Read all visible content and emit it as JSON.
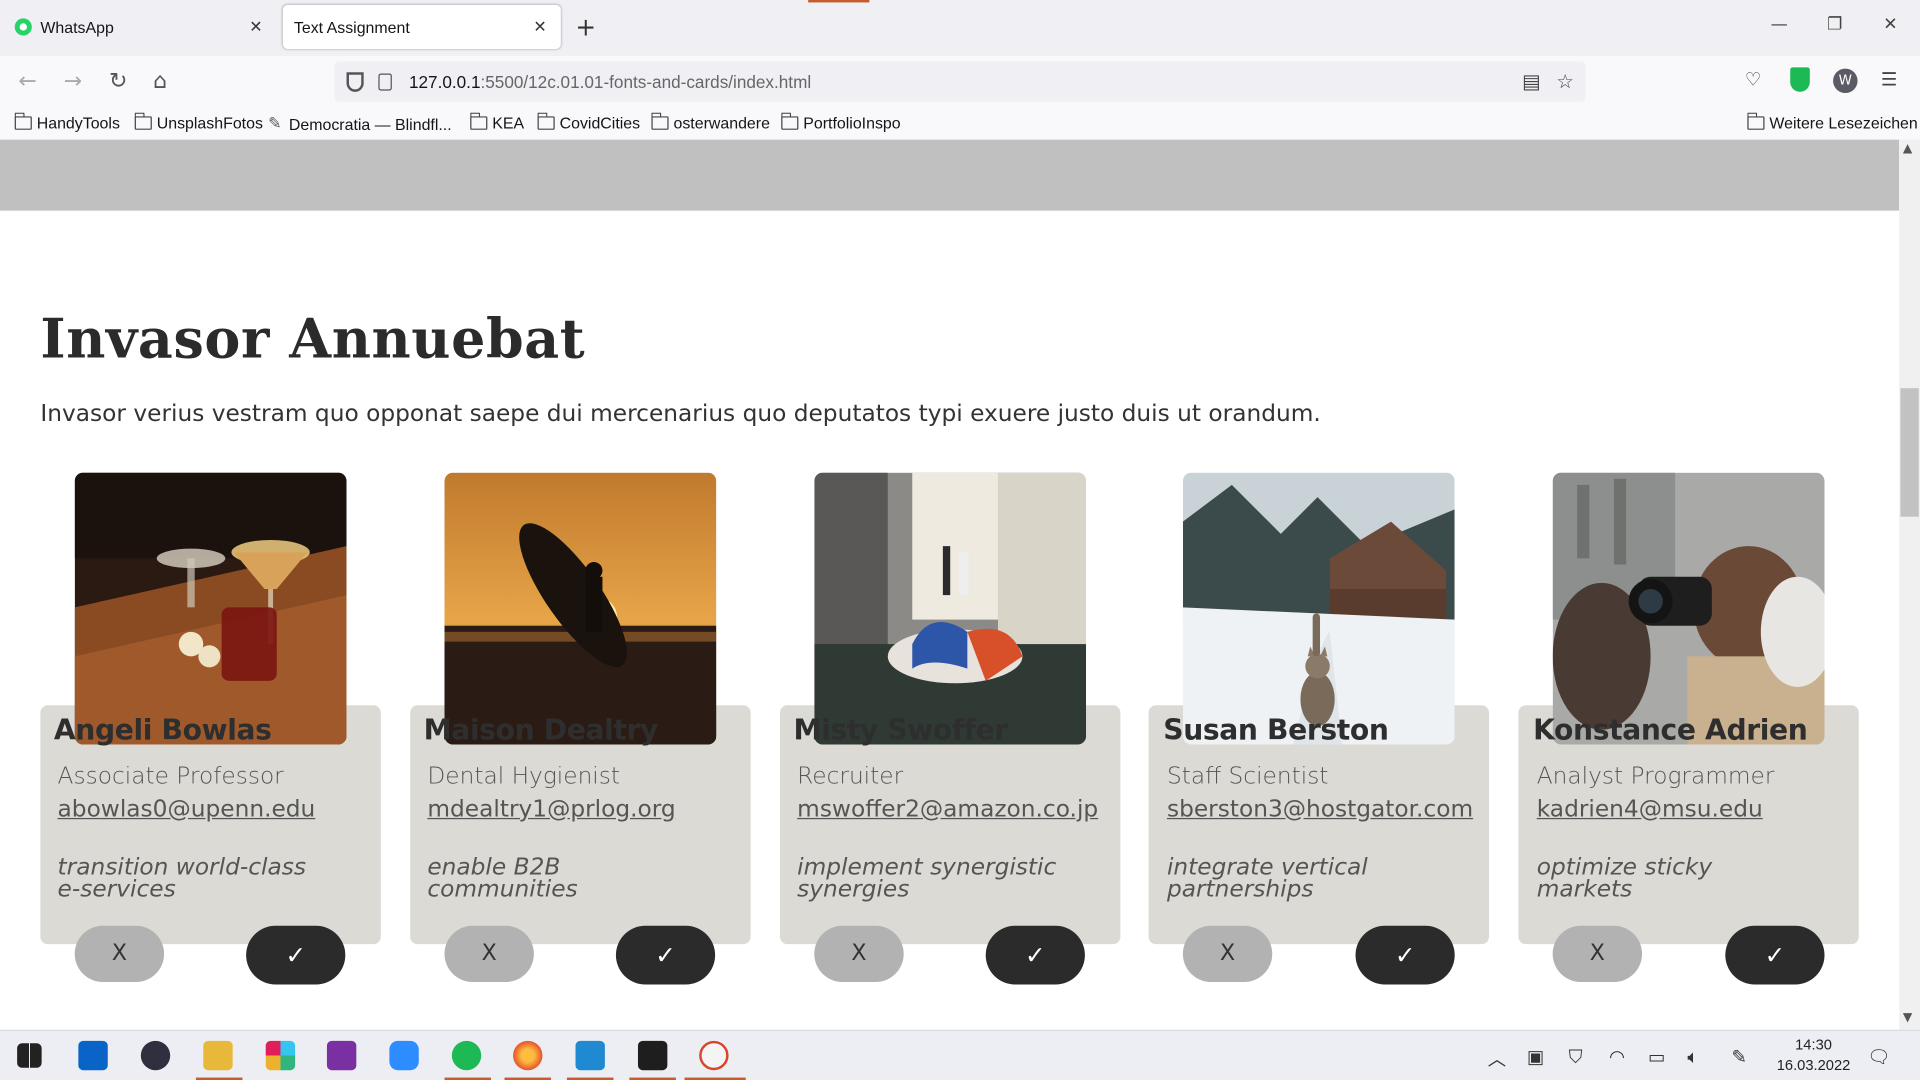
{
  "browser": {
    "tabs": [
      {
        "label": "WhatsApp",
        "active": false
      },
      {
        "label": "Text Assignment",
        "active": true
      }
    ],
    "new_tab": "+",
    "url_host": "127.0.0.1",
    "url_rest": ":5500/12c.01.01-fonts-and-cards/index.html",
    "profile_initial": "W",
    "bookmarks": [
      "HandyTools",
      "UnsplashFotos",
      "Democratia — Blindfl...",
      "KEA",
      "CovidCities",
      "osterwandere",
      "PortfolioInspo"
    ],
    "other_bookmarks": "Weitere Lesezeichen"
  },
  "page": {
    "heading": "Invasor Annuebat",
    "subtitle": "Invasor verius vestram quo opponat saepe dui mercenarius quo deputatos typi exuere justo duis ut orandum.",
    "cards": [
      {
        "name": "Angeli Bowlas",
        "job": "Associate Professor",
        "email": "abowlas0@upenn.edu",
        "motto": "transition world-class e-services",
        "photo": "cocktails"
      },
      {
        "name": "Maison Dealtry",
        "job": "Dental Hygienist",
        "email": "mdealtry1@prlog.org",
        "motto": "enable B2B communities",
        "photo": "surfer-sunset"
      },
      {
        "name": "Misty Swoffer",
        "job": "Recruiter",
        "email": "mswoffer2@amazon.co.jp",
        "motto": "implement synergistic synergies",
        "photo": "sculpture"
      },
      {
        "name": "Susan Berston",
        "job": "Staff Scientist",
        "email": "sberston3@hostgator.com",
        "motto": "integrate vertical partnerships",
        "photo": "cat-snow"
      },
      {
        "name": "Konstance Adrien",
        "job": "Analyst Programmer",
        "email": "kadrien4@msu.edu",
        "motto": "optimize sticky markets",
        "photo": "photographer"
      }
    ],
    "reject_label": "X",
    "accept_label": "✓"
  },
  "taskbar": {
    "time": "14:30",
    "date": "16.03.2022"
  }
}
